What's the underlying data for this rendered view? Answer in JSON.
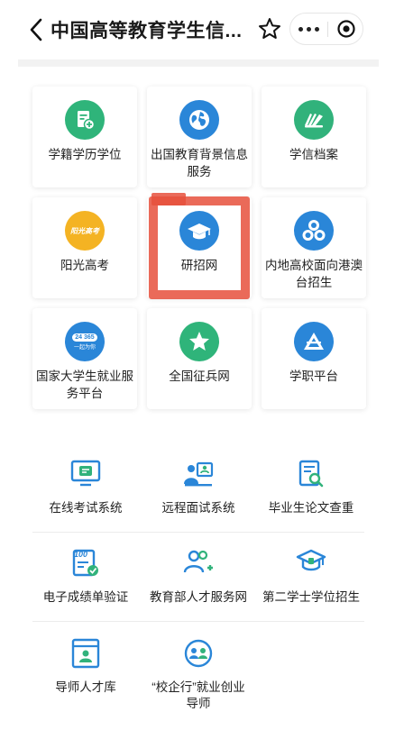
{
  "header": {
    "title": "中国高等教育学生信..."
  },
  "cards": [
    {
      "label": "学籍学历学位",
      "icon": "document-plus-icon",
      "color": "#2fb47a"
    },
    {
      "label": "出国教育背景信息服务",
      "icon": "globe-icon",
      "color": "#2a86d8"
    },
    {
      "label": "学信档案",
      "icon": "books-icon",
      "color": "#31b27b"
    },
    {
      "label": "阳光高考",
      "icon": "sun-logo-icon",
      "color": "#f4b323",
      "logo_text": "阳光高考"
    },
    {
      "label": "研招网",
      "icon": "graduation-cap-icon",
      "color": "#2a86d8"
    },
    {
      "label": "内地高校面向港澳台招生",
      "icon": "three-circles-icon",
      "color": "#2a86d8"
    },
    {
      "label": "国家大学生就业服务平台",
      "icon": "24-365-logo-icon",
      "color": "#2a86d8",
      "logo_text_top": "24 365",
      "logo_text_bottom": "一起为你"
    },
    {
      "label": "全国征兵网",
      "icon": "star-icon",
      "color": "#2fb47a"
    },
    {
      "label": "学职平台",
      "icon": "triangle-logo-icon",
      "color": "#2a86d8"
    }
  ],
  "tools": [
    {
      "label": "在线考试系统",
      "icon": "online-exam-icon"
    },
    {
      "label": "远程面试系统",
      "icon": "remote-interview-icon"
    },
    {
      "label": "毕业生论文查重",
      "icon": "thesis-check-icon"
    },
    {
      "label": "电子成绩单验证",
      "icon": "transcript-verify-icon",
      "badge": "100"
    },
    {
      "label": "教育部人才服务网",
      "icon": "talent-service-icon"
    },
    {
      "label": "第二学士学位招生",
      "icon": "second-degree-icon"
    },
    {
      "label": "导师人才库",
      "icon": "mentor-library-icon"
    },
    {
      "label": "“校企行”就业创业导师",
      "icon": "career-mentor-icon"
    }
  ],
  "colors": {
    "primary_blue": "#2a86d8",
    "green": "#2fb47a",
    "highlight": "#e6503c"
  }
}
